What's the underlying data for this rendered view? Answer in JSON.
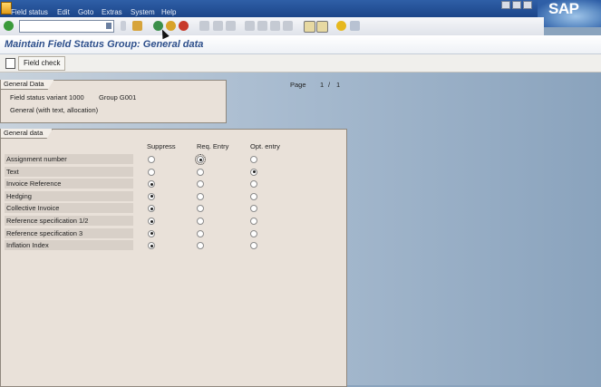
{
  "menubar": {
    "items": [
      "Field status",
      "Edit",
      "Goto",
      "Extras",
      "System",
      "Help"
    ],
    "logo": "SAP"
  },
  "title": "Maintain Field Status Group: General data",
  "app_toolbar": {
    "field_check_label": "Field check"
  },
  "general_data_box": {
    "tab": "General Data",
    "line1": "Field status variant 1000",
    "group": "Group G001",
    "line2": "General (with text, allocation)"
  },
  "page": {
    "label": "Page",
    "current": "1",
    "sep": "/",
    "total": "1"
  },
  "fields_box": {
    "tab": "General data",
    "columns": [
      "Suppress",
      "Req. Entry",
      "Opt. entry"
    ],
    "rows": [
      {
        "label": "Assignment number",
        "selected": 1
      },
      {
        "label": "Text",
        "selected": 2
      },
      {
        "label": "Invoice Reference",
        "selected": 0
      },
      {
        "label": "Hedging",
        "selected": 0
      },
      {
        "label": "Collective Invoice",
        "selected": 0
      },
      {
        "label": "Reference specification 1/2",
        "selected": 0
      },
      {
        "label": "Reference specification 3",
        "selected": 0
      },
      {
        "label": "Inflation Index",
        "selected": 0
      }
    ]
  }
}
